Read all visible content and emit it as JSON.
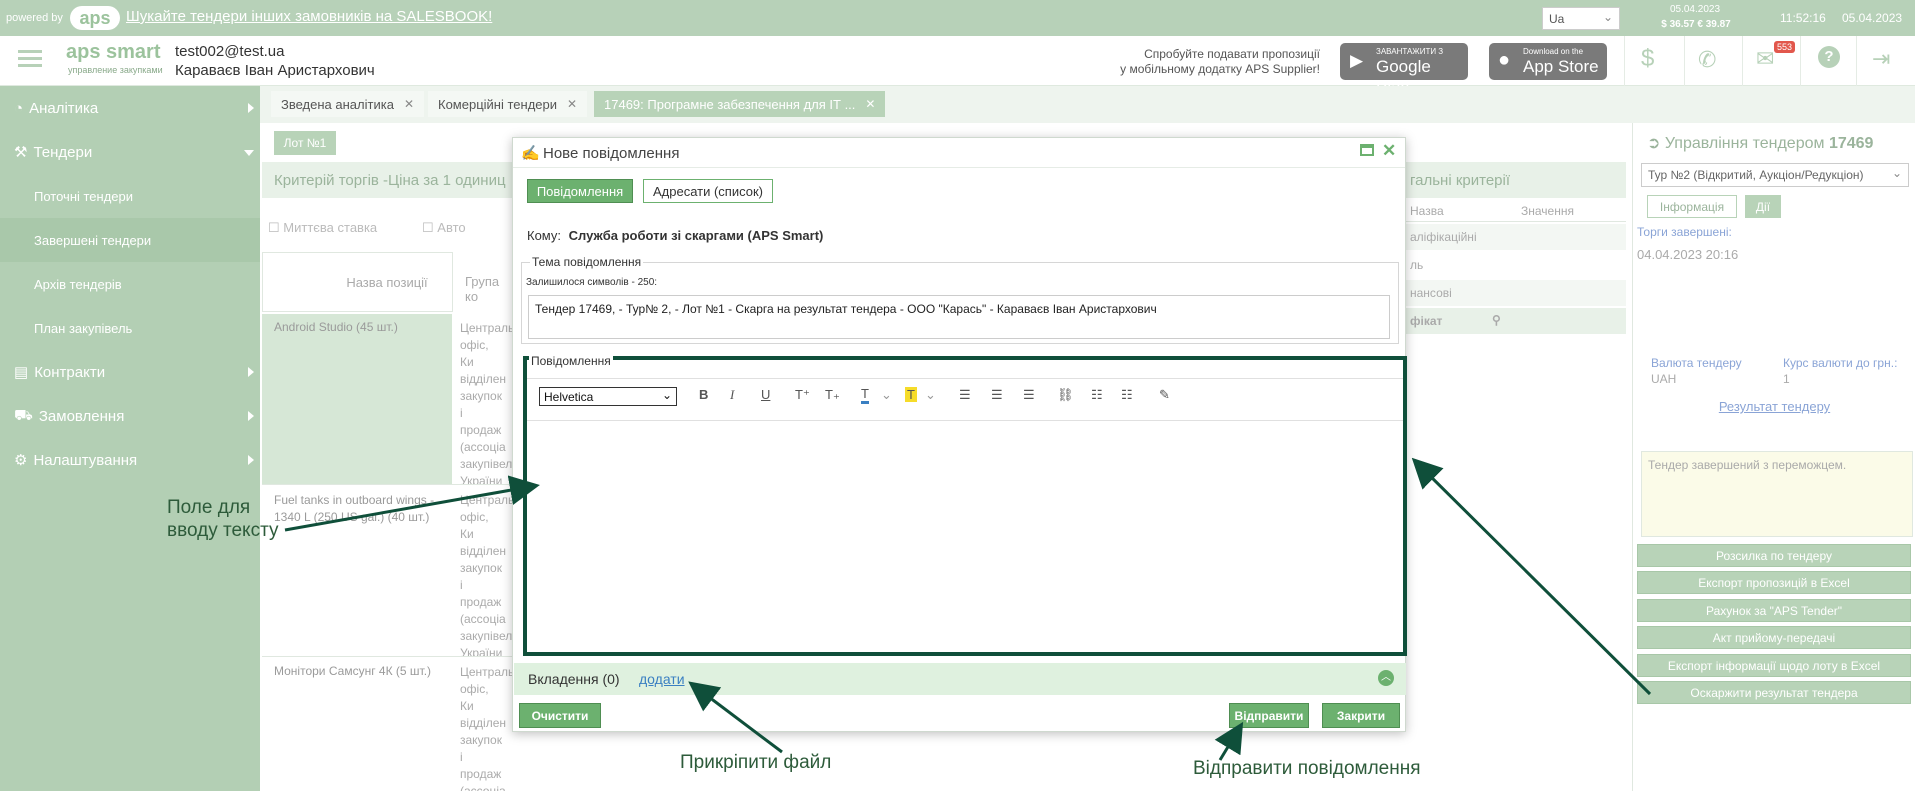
{
  "topbar": {
    "powered_by": "powered by",
    "logo": "aps",
    "promo_link": "Шукайте тендери інших замовників на SALESBOOK!",
    "lang": "Ua",
    "rate_date": "05.04.2023",
    "rate_values": "$ 36.57  € 39.87",
    "time": "11:52:16",
    "date": "05.04.2023"
  },
  "userbar": {
    "logo_main": "aps smart",
    "logo_sub": "управление закупками",
    "email": "test002@test.ua",
    "name": "Караваєв Іван Аристархович",
    "promo_line1": "Спробуйте подавати пропозиції",
    "promo_line2": "у мобільному додатку APS Supplier!",
    "google_small": "ЗАВАНТАЖИТИ З",
    "google_big": "Google Play",
    "apple_small": "Download on the",
    "apple_big": "App Store",
    "mail_badge": "553"
  },
  "sidebar": {
    "items": [
      {
        "label": "Аналітика"
      },
      {
        "label": "Тендери"
      },
      {
        "label": "Поточні тендери"
      },
      {
        "label": "Завершені тендери"
      },
      {
        "label": "Архів тендерів"
      },
      {
        "label": "План закупівель"
      },
      {
        "label": "Контракти"
      },
      {
        "label": "Замовлення"
      },
      {
        "label": "Налаштування"
      }
    ]
  },
  "tabs": [
    {
      "label": "Зведена аналітика"
    },
    {
      "label": "Комерційні тендери"
    },
    {
      "label": "17469: Програмне забезпечення для ІТ ..."
    }
  ],
  "content": {
    "lot": "Лот №1",
    "criteria_title": "Критерій торгів -Ціна за 1 одиниц",
    "instant_bid": "Миттєва ставка",
    "auto": "Авто",
    "col_position": "Назва позиції",
    "col_group": "Група ко",
    "rows": [
      {
        "name": "Android Studio (45 шт.)",
        "group": "Централь офіс, Ки відділен закупок і продаж (ассоціа закупівел України в Києві)"
      },
      {
        "name": "Fuel tanks in outboard wings - 1340 L (250 US gal.) (40 шт.)",
        "group": "Централь офіс, Ки відділен закупок і продаж (ассоціа закупівел України в Києві)"
      },
      {
        "name": "Монітори Самсунг 4К (5 шт.)",
        "group": "Централь офіс, Ки відділен закупок і продаж (ассоціа закупівел"
      }
    ],
    "general_criteria": "гальні критерії",
    "gc_col_name": "Назва",
    "gc_col_value": "Значення",
    "gc_rows": [
      "аліфікаційні",
      "ль",
      "нансові",
      "фікат"
    ]
  },
  "right_panel": {
    "title_prefix": "Управління тендером",
    "tender_no": "17469",
    "round_select": "Тур №2 (Відкритий, Аукціон/Редукціон)",
    "tab_info": "Інформація",
    "tab_actions": "Дії",
    "finished_label": "Торги завершені:",
    "finished_date": "04.04.2023 20:16",
    "currency_label": "Валюта тендеру",
    "currency_value": "UAH",
    "rate_label": "Курс валюти до грн.:",
    "rate_value": "1",
    "result_link": "Результат тендеру",
    "status_text": "Тендер завершений з переможцем.",
    "buttons": [
      "Розсилка по тендеру",
      "Експорт пропозицій в Excel",
      "Рахунок за \"APS Tender\"",
      "Акт прийому-передачі",
      "Експорт інформації щодо лоту в Excel",
      "Оскаржити результат тендера"
    ]
  },
  "modal": {
    "title": "Нове повідомлення",
    "tab_message": "Повідомлення",
    "tab_recipients": "Адресати (список)",
    "to_label": "Кому:",
    "to_value": "Служба роботи зі скаргами (APS Smart)",
    "subject_legend": "Тема повідомлення",
    "chars_left": "Залишилося символів - 250:",
    "subject_value": "Тендер 17469, - Тур№ 2, - Лот №1 - Скарга на результат тендера - ООО \"Карась\" - Караваєв Іван Аристархович",
    "message_legend": "Повідомлення",
    "font_select": "Helvetica",
    "attachments": "Вкладення (0)",
    "add_link": "додати",
    "clear_btn": "Очистити",
    "send_btn": "Відправити",
    "close_btn": "Закрити"
  },
  "annotations": {
    "text_field_line1": "Поле для",
    "text_field_line2": "вводу тексту",
    "attach_file": "Прикріпити файл",
    "send_message": "Відправити повідомлення"
  },
  "colors": {
    "accent": "#6cb16f",
    "dark_frame": "#0f4f3a",
    "link": "#3a7fc2"
  }
}
